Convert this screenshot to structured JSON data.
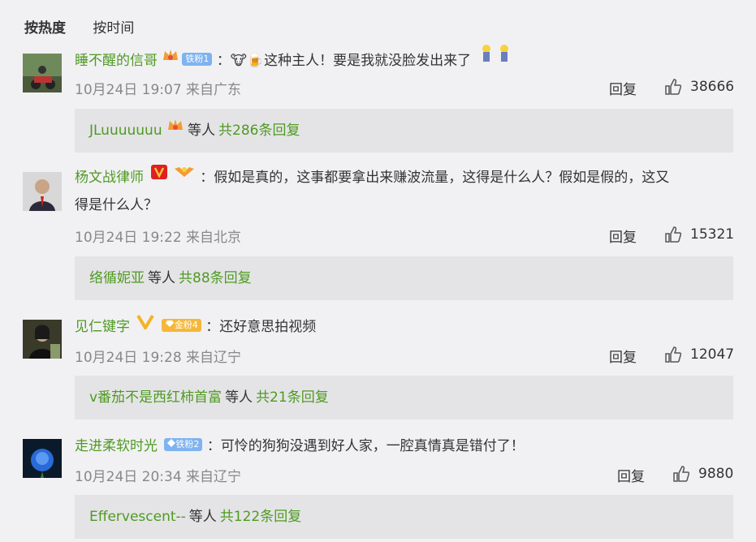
{
  "tabs": {
    "hot": "按热度",
    "time": "按时间"
  },
  "comments": [
    {
      "user": "睡不醒的信哥",
      "badge": "铁粉1",
      "text": "：🐮🍺这种主人！要是我就没脸发出来了",
      "text2": "",
      "date": "10月24日 19:07 来自广东",
      "reply": "回复",
      "likes": "38666",
      "sub_user": "JLuuuuuuu",
      "sub_mid": "等人",
      "sub_count": "共286条回复"
    },
    {
      "user": "杨文战律师",
      "badge": "",
      "text": "：假如是真的，这事都要拿出来赚波流量，这得是什么人？假如是假的，这又",
      "text2": "得是什么人？",
      "date": "10月24日 19:22 来自北京",
      "reply": "回复",
      "likes": "15321",
      "sub_user": "络循妮亚",
      "sub_mid": "等人",
      "sub_count": "共88条回复"
    },
    {
      "user": "见仁键字",
      "badge": "金粉4",
      "text": "：还好意思拍视频",
      "text2": "",
      "date": "10月24日 19:28 来自辽宁",
      "reply": "回复",
      "likes": "12047",
      "sub_user": "v番茄不是西红柿首富",
      "sub_mid": "等人",
      "sub_count": "共21条回复"
    },
    {
      "user": "走进柔软时光",
      "badge": "铁粉2",
      "text": "：可怜的狗狗没遇到好人家，一腔真情真是错付了！",
      "text2": "",
      "date": "10月24日 20:34 来自辽宁",
      "reply": "回复",
      "likes": "9880",
      "sub_user": "Effervescent--",
      "sub_mid": "等人",
      "sub_count": "共122条回复"
    }
  ],
  "colors": {
    "link": "#4f9a22",
    "background": "#f1f1f3",
    "subpanel": "#e4e4e6"
  }
}
